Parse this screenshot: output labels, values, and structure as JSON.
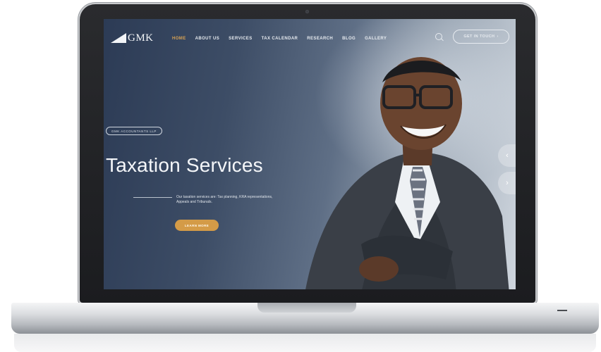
{
  "site": {
    "logo_text": "GMK",
    "nav": [
      "HOME",
      "ABOUT US",
      "SERVICES",
      "TAX CALENDAR",
      "RESEARCH",
      "BLOG",
      "GALLERY"
    ],
    "active_nav": "HOME",
    "cta_label": "GET IN TOUCH"
  },
  "hero": {
    "tag": "GMK ACCOUNTANTS LLP",
    "title": "Taxation Services",
    "description": "Our taxation services are: Tax planning, KRA representations, Appeals and Tribunals.",
    "button": "LEARN MORE"
  },
  "colors": {
    "accent": "#d7a153",
    "button": "#d49b47",
    "screen_dark": "#2c3b55"
  },
  "icons": {
    "search": "search-icon",
    "cta_arrow": "arrow-right-icon",
    "prev": "chevron-left-icon",
    "next": "chevron-right-icon"
  }
}
